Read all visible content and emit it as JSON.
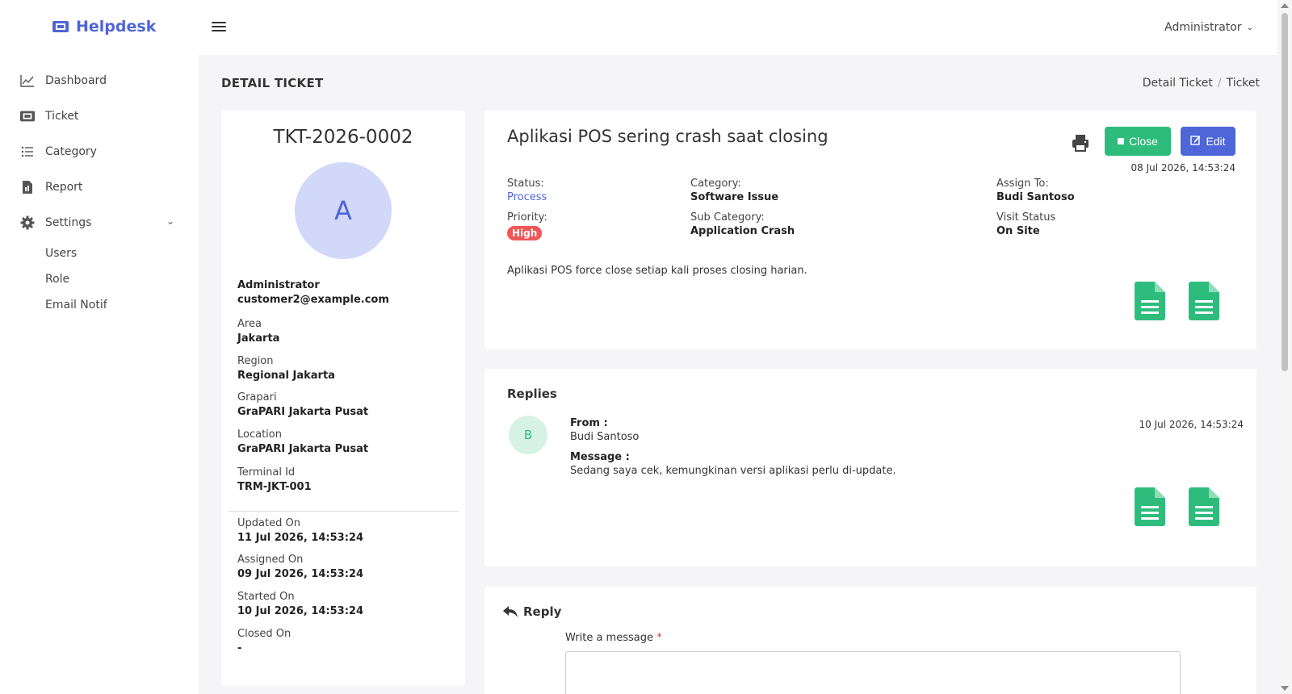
{
  "app": {
    "brand": "Helpdesk"
  },
  "header": {
    "user": "Administrator"
  },
  "sidebar": {
    "items": [
      {
        "label": "Dashboard",
        "icon": "chart-line-icon"
      },
      {
        "label": "Ticket",
        "icon": "ticket-icon"
      },
      {
        "label": "Category",
        "icon": "list-icon"
      },
      {
        "label": "Report",
        "icon": "report-file-icon"
      },
      {
        "label": "Settings",
        "icon": "gear-icon"
      }
    ],
    "settings_sub": [
      "Users",
      "Role",
      "Email Notif"
    ]
  },
  "page": {
    "title": "DETAIL TICKET",
    "breadcrumb": [
      "Detail Ticket",
      "Ticket"
    ]
  },
  "ticket_info": {
    "number": "TKT-2026-0002",
    "avatar_letter": "A",
    "name": "Administrator",
    "email": "customer2@example.com",
    "fields": [
      {
        "label": "Area",
        "value": "Jakarta"
      },
      {
        "label": "Region",
        "value": "Regional Jakarta"
      },
      {
        "label": "Grapari",
        "value": "GraPARI Jakarta Pusat"
      },
      {
        "label": "Location",
        "value": "GraPARI Jakarta Pusat"
      },
      {
        "label": "Terminal Id",
        "value": "TRM-JKT-001"
      }
    ],
    "dates": [
      {
        "label": "Updated On",
        "value": "11 Jul 2026, 14:53:24"
      },
      {
        "label": "Assigned On",
        "value": "09 Jul 2026, 14:53:24"
      },
      {
        "label": "Started On",
        "value": "10 Jul 2026, 14:53:24"
      },
      {
        "label": "Closed On",
        "value": "-"
      }
    ]
  },
  "detail": {
    "title": "Aplikasi POS sering crash saat closing",
    "close_label": "Close",
    "edit_label": "Edit",
    "date": "08 Jul 2026, 14:53:24",
    "status_label": "Status:",
    "status": "Process",
    "priority_label": "Priority:",
    "priority": "High",
    "category_label": "Category:",
    "category": "Software Issue",
    "sub_category_label": "Sub Category:",
    "sub_category": "Application Crash",
    "assign_label": "Assign To:",
    "assign": "Budi Santoso",
    "visit_label": "Visit Status",
    "visit": "On Site",
    "description": "Aplikasi POS force close setiap kali proses closing harian.",
    "colors": {
      "primary": "#4f66d8",
      "success": "#2ebc7c",
      "danger": "#f05656"
    }
  },
  "replies": {
    "title": "Replies",
    "avatar_letter": "B",
    "from_label": "From :",
    "from": "Budi Santoso",
    "message_label": "Message :",
    "message": "Sedang saya cek, kemungkinan versi aplikasi perlu di-update.",
    "date": "10 Jul 2026, 14:53:24"
  },
  "reply_form": {
    "title": "Reply",
    "label": "Write a message",
    "required": "*",
    "value": ""
  }
}
